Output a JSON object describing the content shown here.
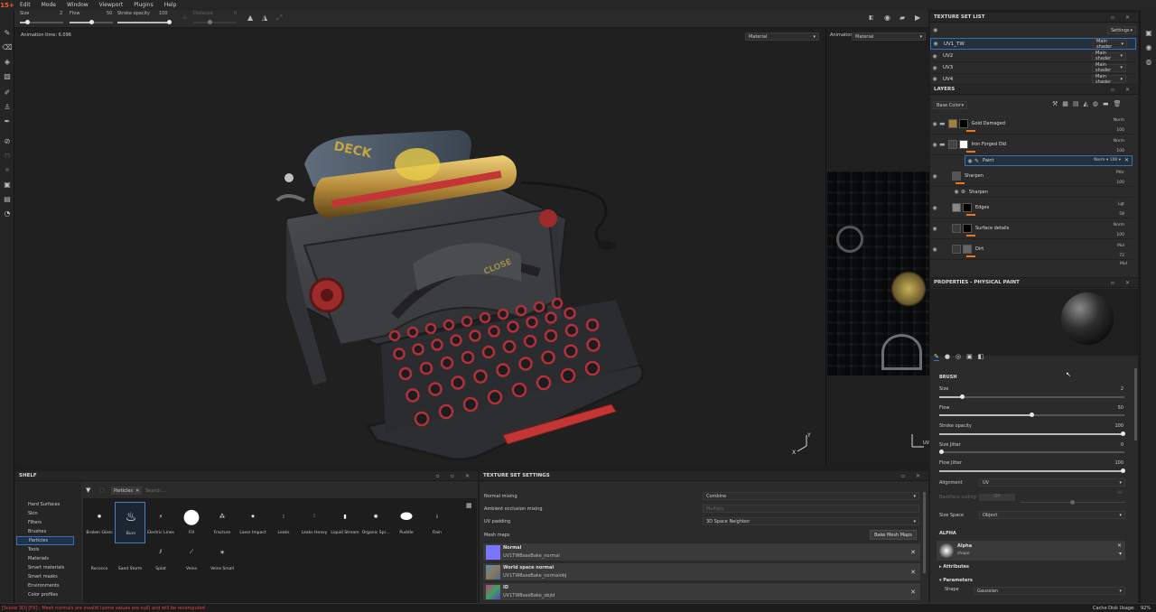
{
  "app": {
    "logo": "15+"
  },
  "menu": [
    "Edit",
    "Mode",
    "Window",
    "Viewport",
    "Plugins",
    "Help"
  ],
  "tool_options": {
    "size_label": "Size",
    "size_value": "2",
    "flow_label": "Flow",
    "flow_value": "50",
    "stroke_label": "Stroke opacity",
    "stroke_value": "100",
    "distance_label": "Distance",
    "distance_value": "0"
  },
  "viewport": {
    "animation_time": "Animation time: 6.096",
    "mode_left": "Material",
    "mode_right_label": "Animation",
    "mode_right": "Material",
    "uv_right_label": "UV"
  },
  "model_text": {
    "deck": "DECK",
    "close": "CLOSE"
  },
  "texture_set_list": {
    "title": "Texture Set List",
    "settings": "Settings",
    "rows": [
      {
        "name": "UV1_TW",
        "shader": "Main shader"
      },
      {
        "name": "UV2",
        "shader": "Main shader"
      },
      {
        "name": "UV3",
        "shader": "Main shader"
      },
      {
        "name": "UV4",
        "shader": "Main shader"
      }
    ]
  },
  "layers": {
    "title": "Layers",
    "channel": "Base Color",
    "items": [
      {
        "name": "Gold Damaged",
        "blend": "Norm",
        "opacity": "100"
      },
      {
        "name": "Iron Forged Old",
        "blend": "Norm",
        "opacity": "100"
      },
      {
        "name": "Paint",
        "blend": "Norm",
        "opacity": "100"
      },
      {
        "name": "Sharpen",
        "blend": "Pthr",
        "opacity": "100"
      },
      {
        "name": "Sharpen",
        "blend": "",
        "opacity": ""
      },
      {
        "name": "Edges",
        "blend": "Lgt",
        "opacity": "58"
      },
      {
        "name": "Surface details",
        "blend": "Norm",
        "opacity": "100"
      },
      {
        "name": "Dirt",
        "blend": "Mul",
        "opacity": "72"
      }
    ],
    "last_blend": "Mul"
  },
  "properties": {
    "title": "Properties - Physical Paint",
    "brush_heading": "BRUSH",
    "size_label": "Size",
    "size_value": "2",
    "flow_label": "Flow",
    "flow_value": "50",
    "stroke_label": "Stroke opacity",
    "stroke_value": "100",
    "sizejit_label": "Size Jitter",
    "sizejit_value": "0",
    "flowjit_label": "Flow Jitter",
    "flowjit_value": "100",
    "alignment_label": "Alignment",
    "alignment_value": "UV",
    "backface_label": "Backface culling",
    "backface_value": "Off",
    "backface_num": "90",
    "sizespace_label": "Size Space",
    "sizespace_value": "Object",
    "alpha_heading": "ALPHA",
    "alpha_name": "Alpha",
    "alpha_sub": "shape",
    "attributes": "Attributes",
    "parameters": "Parameters",
    "shape_label": "Shape",
    "shape_value": "Gaussian"
  },
  "shelf": {
    "title": "Shelf",
    "filter_tag": "Particles",
    "search_placeholder": "Search...",
    "categories": [
      "Hard Surfaces",
      "Skin",
      "Filters",
      "Brushes",
      "Particles",
      "Tools",
      "Materials",
      "Smart materials",
      "Smart masks",
      "Environments",
      "Color profiles"
    ],
    "selected_category": "Particles",
    "items": [
      "Broken Glass",
      "Burn",
      "Electric Lines",
      "Fill",
      "Fracture",
      "Laser Impact",
      "Leaks",
      "Leaks Heavy",
      "Liquid Stream",
      "Organic Spr...",
      "Puddle",
      "Rain",
      "Rococco",
      "Sand Storm",
      "Splat",
      "Veins",
      "Veins Small"
    ],
    "selected_item": "Burn"
  },
  "tss": {
    "title": "Texture Set Settings",
    "normal_mixing_label": "Normal mixing",
    "normal_mixing_value": "Combine",
    "ao_mixing_label": "Ambient occlusion mixing",
    "ao_mixing_value": "Multiply",
    "uv_padding_label": "UV padding",
    "uv_padding_value": "3D Space Neighbor",
    "mesh_maps_label": "Mesh maps",
    "bake_button": "Bake Mesh Maps",
    "maps": [
      {
        "title": "Normal",
        "file": "UV1TWBaseBake_normal",
        "color": "#7b74ff"
      },
      {
        "title": "World space normal",
        "file": "UV1TWBaseBake_normalobj",
        "color": "#6aa0c0"
      },
      {
        "title": "ID",
        "file": "UV1TWBaseBake_objid",
        "color": "#c04070"
      }
    ]
  },
  "status": {
    "message": "[Scene 3D] [FX] : Mesh normals are invalid (some values are null) and will be recomputed",
    "cache_label": "Cache Disk Usage:",
    "cache_value": "92%"
  },
  "colors": {
    "accent": "#e87722",
    "selection": "#3d6fb0",
    "status_error": "#e0463a"
  }
}
